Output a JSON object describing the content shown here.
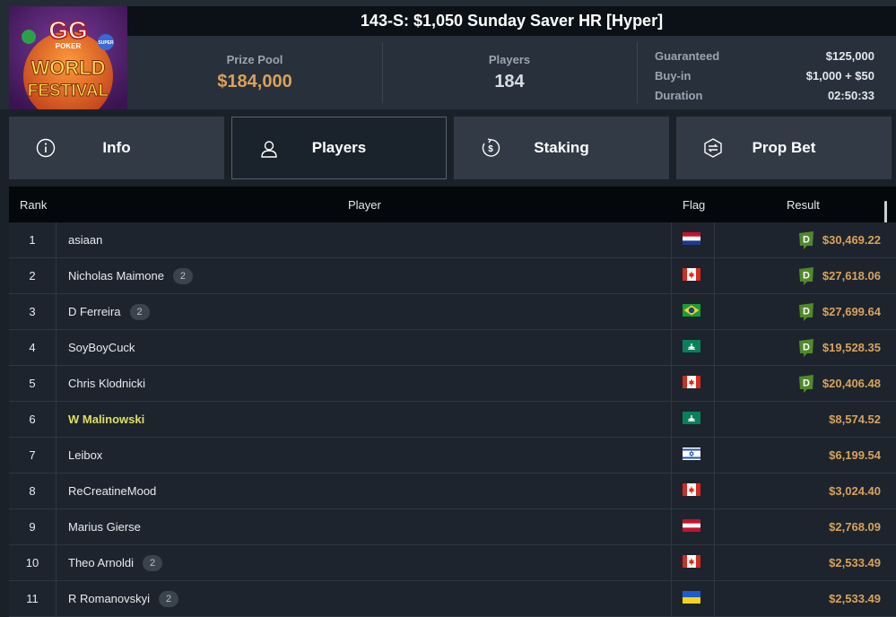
{
  "tournament": {
    "title": "143-S: $1,050 Sunday Saver HR [Hyper]",
    "logo": {
      "top_text": "GG",
      "sub_text": "POKER",
      "line1": "WORLD",
      "line2": "FESTIVAL",
      "side_text": "SUPER"
    }
  },
  "stats": {
    "prize_pool_label": "Prize Pool",
    "prize_pool_value": "$184,000",
    "players_label": "Players",
    "players_value": "184"
  },
  "details": [
    {
      "key": "Guaranteed",
      "value": "$125,000"
    },
    {
      "key": "Buy-in",
      "value": "$1,000 + $50"
    },
    {
      "key": "Duration",
      "value": "02:50:33"
    }
  ],
  "tabs": [
    {
      "label": "Info",
      "icon": "info-icon"
    },
    {
      "label": "Players",
      "icon": "user-icon",
      "active": true
    },
    {
      "label": "Staking",
      "icon": "dollar-coin-icon"
    },
    {
      "label": "Prop Bet",
      "icon": "prop-bet-icon"
    }
  ],
  "table": {
    "headers": {
      "rank": "Rank",
      "player": "Player",
      "flag": "Flag",
      "result": "Result"
    },
    "rows": [
      {
        "rank": "1",
        "player": "asiaan",
        "badge": "",
        "flag": "netherlands-flag",
        "staked": true,
        "result": "$30,469.22",
        "highlight": false
      },
      {
        "rank": "2",
        "player": "Nicholas Maimone",
        "badge": "2",
        "flag": "canada-flag",
        "staked": true,
        "result": "$27,618.06",
        "highlight": false
      },
      {
        "rank": "3",
        "player": "D Ferreira",
        "badge": "2",
        "flag": "brazil-flag",
        "staked": true,
        "result": "$27,699.64",
        "highlight": false
      },
      {
        "rank": "4",
        "player": "SoyBoyCuck",
        "badge": "",
        "flag": "macau-flag",
        "staked": true,
        "result": "$19,528.35",
        "highlight": false
      },
      {
        "rank": "5",
        "player": "Chris Klodnicki",
        "badge": "",
        "flag": "canada-flag",
        "staked": true,
        "result": "$20,406.48",
        "highlight": false
      },
      {
        "rank": "6",
        "player": "W Malinowski",
        "badge": "",
        "flag": "macau-flag",
        "staked": false,
        "result": "$8,574.52",
        "highlight": true
      },
      {
        "rank": "7",
        "player": "Leibox",
        "badge": "",
        "flag": "israel-flag",
        "staked": false,
        "result": "$6,199.54",
        "highlight": false
      },
      {
        "rank": "8",
        "player": "ReCreatineMood",
        "badge": "",
        "flag": "canada-flag",
        "staked": false,
        "result": "$3,024.40",
        "highlight": false
      },
      {
        "rank": "9",
        "player": "Marius Gierse",
        "badge": "",
        "flag": "austria-flag",
        "staked": false,
        "result": "$2,768.09",
        "highlight": false
      },
      {
        "rank": "10",
        "player": "Theo Arnoldi",
        "badge": "2",
        "flag": "canada-flag",
        "staked": false,
        "result": "$2,533.49",
        "highlight": false
      },
      {
        "rank": "11",
        "player": "R Romanovskyi",
        "badge": "2",
        "flag": "ukraine-flag",
        "staked": false,
        "result": "$2,533.49",
        "highlight": false
      }
    ]
  },
  "colors": {
    "gold": "#d9a25a",
    "highlight_name": "#dde05f",
    "staking_green": "#4f8a2a"
  }
}
